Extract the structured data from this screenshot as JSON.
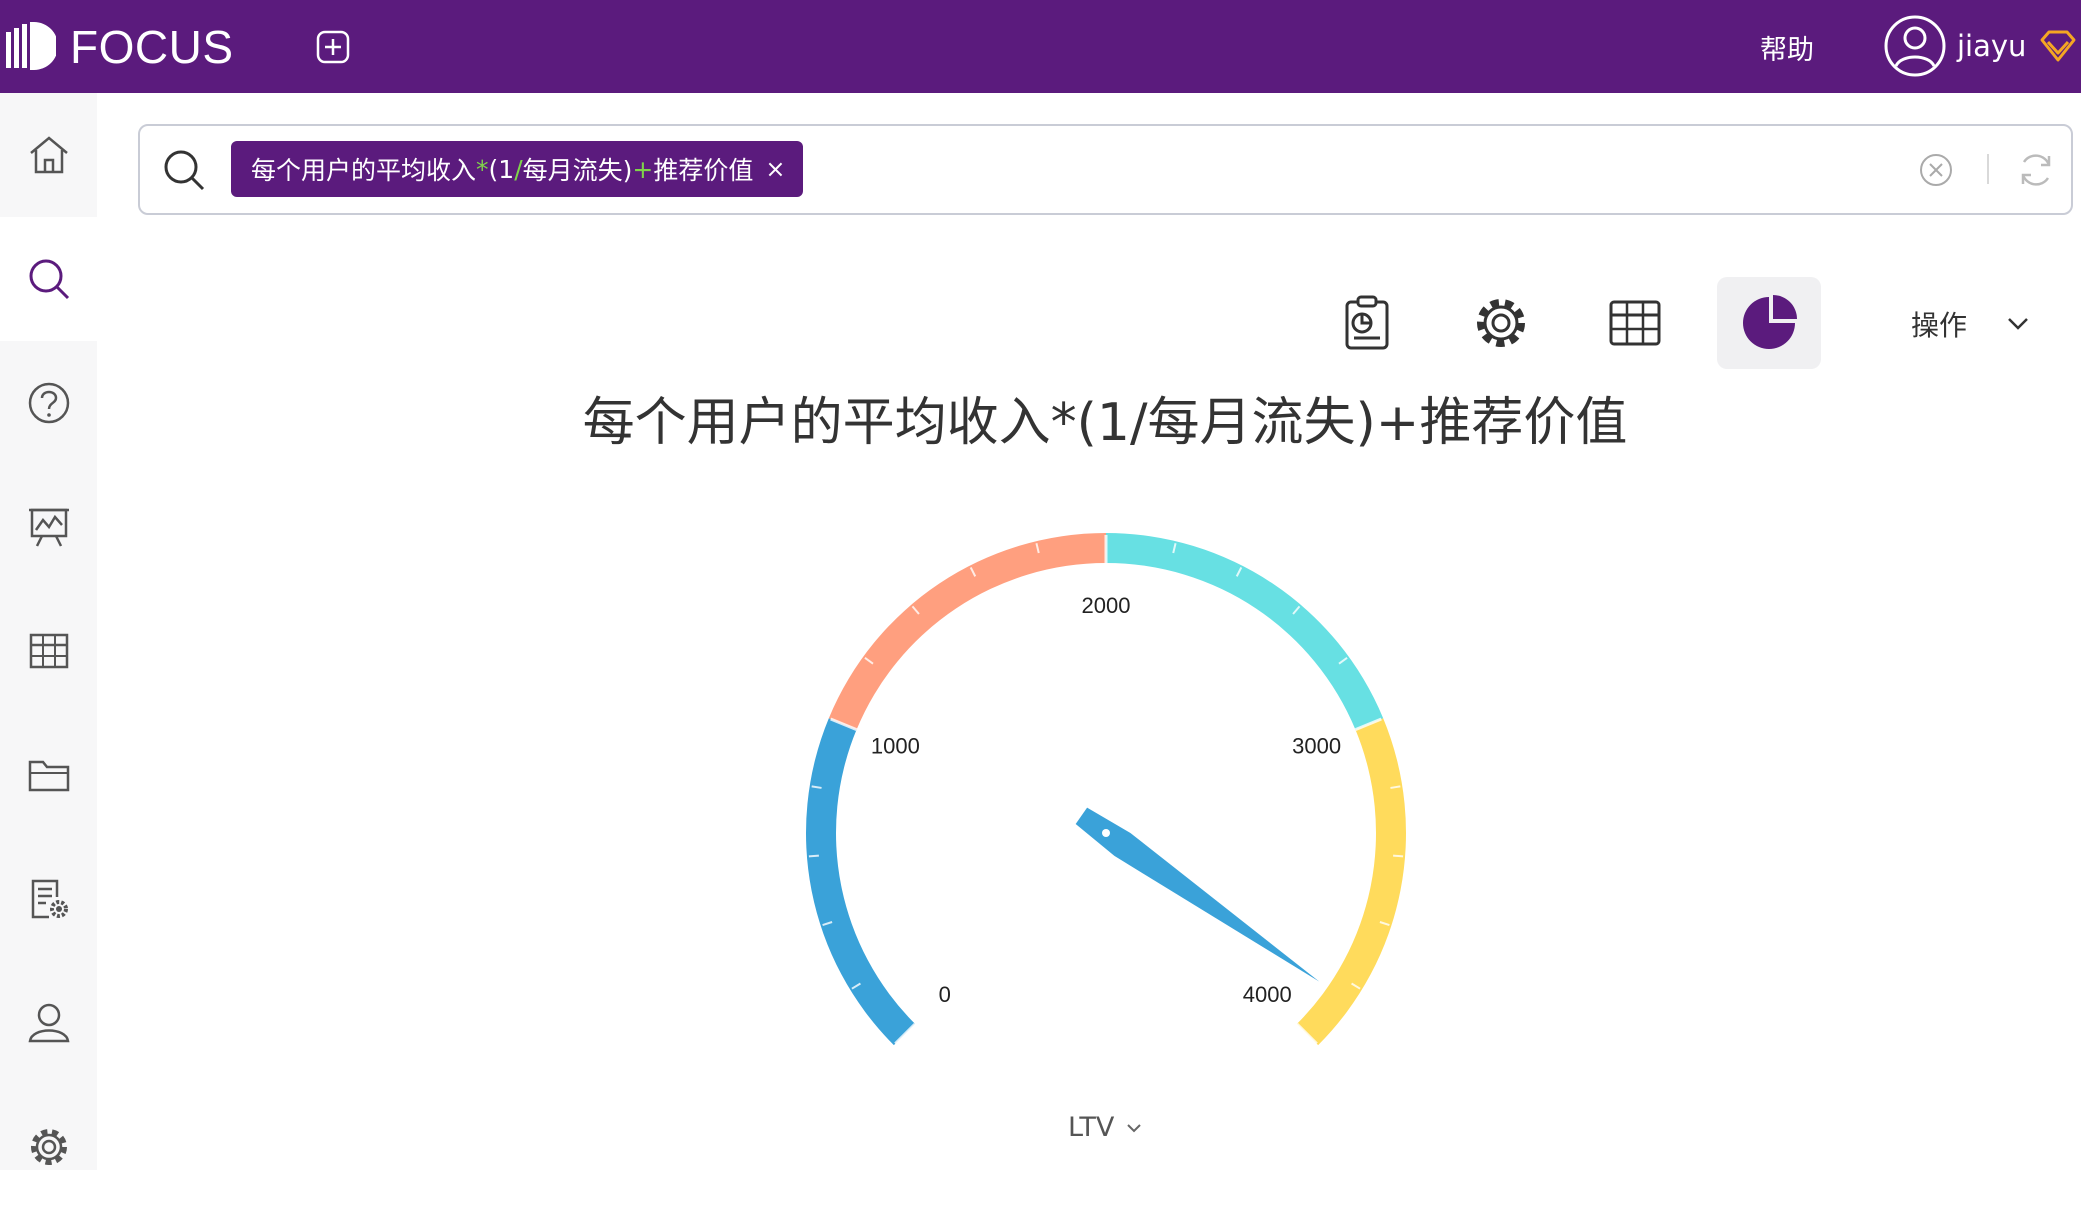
{
  "header": {
    "brand": "FOCUS",
    "help_label": "帮助",
    "username": "jiayu"
  },
  "sidebar": {
    "items": [
      {
        "icon": "home-icon",
        "active": false
      },
      {
        "icon": "search-icon",
        "active": true
      },
      {
        "icon": "question-icon",
        "active": false
      },
      {
        "icon": "presentation-icon",
        "active": false
      },
      {
        "icon": "table-icon",
        "active": false
      },
      {
        "icon": "folder-icon",
        "active": false
      },
      {
        "icon": "report-settings-icon",
        "active": false
      },
      {
        "icon": "user-icon",
        "active": false
      },
      {
        "icon": "gear-icon",
        "active": false
      }
    ]
  },
  "search": {
    "chip_part1": "每个用户的平均收入",
    "chip_op1": "*",
    "chip_part2": "(1",
    "chip_op2": "/",
    "chip_part3": "每月流失)",
    "chip_op3": "+",
    "chip_part4": "推荐价值",
    "chip_close": "×"
  },
  "toolbar": {
    "ops_label": "操作",
    "tools": [
      "report-clipboard-icon",
      "settings-gear-icon",
      "table-view-icon",
      "pie-chart-icon"
    ]
  },
  "colors": {
    "brand": "#5b1b7d",
    "band1": "#3aa2d9",
    "band2": "#ff9f7f",
    "band3": "#67e0e3",
    "band4": "#ffdb5c",
    "pointer": "#3aa2d9"
  },
  "chart_data": {
    "type": "gauge",
    "title": "每个用户的平均收入*(1/每月流失)+推荐价值",
    "min": 0,
    "max": 4000,
    "value": 3850,
    "ticks": [
      0,
      1000,
      2000,
      3000,
      4000
    ],
    "tick_labels": [
      "0",
      "1000",
      "2000",
      "3000",
      "4000"
    ],
    "bands": [
      {
        "from": 0,
        "to": 1000,
        "color": "#3aa2d9"
      },
      {
        "from": 1000,
        "to": 2000,
        "color": "#ff9f7f"
      },
      {
        "from": 2000,
        "to": 3000,
        "color": "#67e0e3"
      },
      {
        "from": 3000,
        "to": 4000,
        "color": "#ffdb5c"
      }
    ],
    "measure_label": "LTV"
  }
}
